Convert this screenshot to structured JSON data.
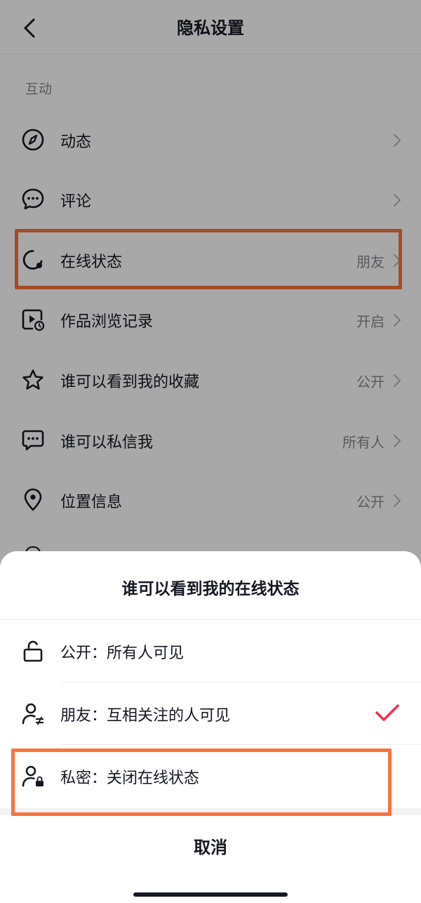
{
  "header": {
    "title": "隐私设置",
    "back_icon": "chevron-left-icon"
  },
  "section": {
    "title": "互动"
  },
  "rows": [
    {
      "label": "动态",
      "value": "",
      "icon": "compass-icon"
    },
    {
      "label": "评论",
      "value": "",
      "icon": "comment-bubble-icon"
    },
    {
      "label": "在线状态",
      "value": "朋友",
      "icon": "online-status-icon"
    },
    {
      "label": "作品浏览记录",
      "value": "开启",
      "icon": "video-history-icon"
    },
    {
      "label": "谁可以看到我的收藏",
      "value": "公开",
      "icon": "star-icon"
    },
    {
      "label": "谁可以私信我",
      "value": "所有人",
      "icon": "message-icon"
    },
    {
      "label": "位置信息",
      "value": "公开",
      "icon": "location-pin-icon"
    }
  ],
  "sheet": {
    "title": "谁可以看到我的在线状态",
    "options": [
      {
        "label": "公开：所有人可见",
        "icon": "unlock-icon",
        "selected": false
      },
      {
        "label": "朋友：互相关注的人可见",
        "icon": "user-mutual-icon",
        "selected": true
      },
      {
        "label": "私密：关闭在线状态",
        "icon": "user-lock-icon",
        "selected": false
      }
    ],
    "cancel": "取消"
  },
  "colors": {
    "highlight": "#f8743d",
    "check": "#fe2c55",
    "overlay": "rgba(0,0,0,0.34)",
    "text": "#161823",
    "secondary_text": "#8a8b91"
  }
}
